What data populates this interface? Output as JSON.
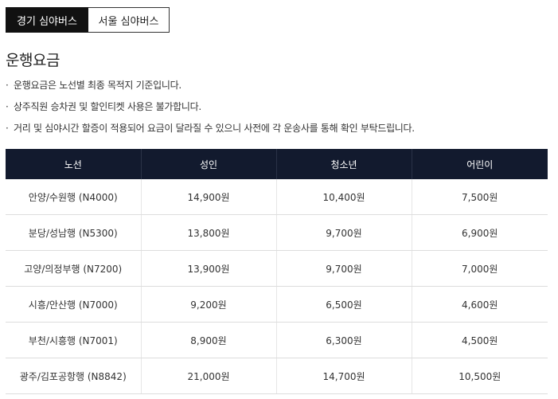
{
  "tabs": [
    {
      "label": "경기 심야버스",
      "active": true
    },
    {
      "label": "서울 심야버스",
      "active": false
    }
  ],
  "section": {
    "title": "운행요금"
  },
  "notes": {
    "bullet": "·",
    "items": [
      "운행요금은 노선별 최종 목적지 기준입니다.",
      "상주직원 승차권 및 할인티켓 사용은 불가합니다.",
      "거리 및 심야시간 할증이 적용되어 요금이 달라질 수 있으니 사전에 각 운송사를 통해 확인 부탁드립니다."
    ]
  },
  "fare_table": {
    "headers": [
      "노선",
      "성인",
      "청소년",
      "어린이"
    ],
    "rows": [
      [
        "안양/수원행 (N4000)",
        "14,900원",
        "10,400원",
        "7,500원"
      ],
      [
        "분당/성남행 (N5300)",
        "13,800원",
        "9,700원",
        "6,900원"
      ],
      [
        "고양/의정부행 (N7200)",
        "13,900원",
        "9,700원",
        "7,000원"
      ],
      [
        "시흥/안산행 (N7000)",
        "9,200원",
        "6,500원",
        "4,600원"
      ],
      [
        "부천/시흥행 (N7001)",
        "8,900원",
        "6,300원",
        "4,500원"
      ],
      [
        "광주/김포공항행 (N8842)",
        "21,000원",
        "14,700원",
        "10,500원"
      ]
    ]
  },
  "colors": {
    "active_tab": "#111111",
    "table_header": "#121a2e"
  }
}
